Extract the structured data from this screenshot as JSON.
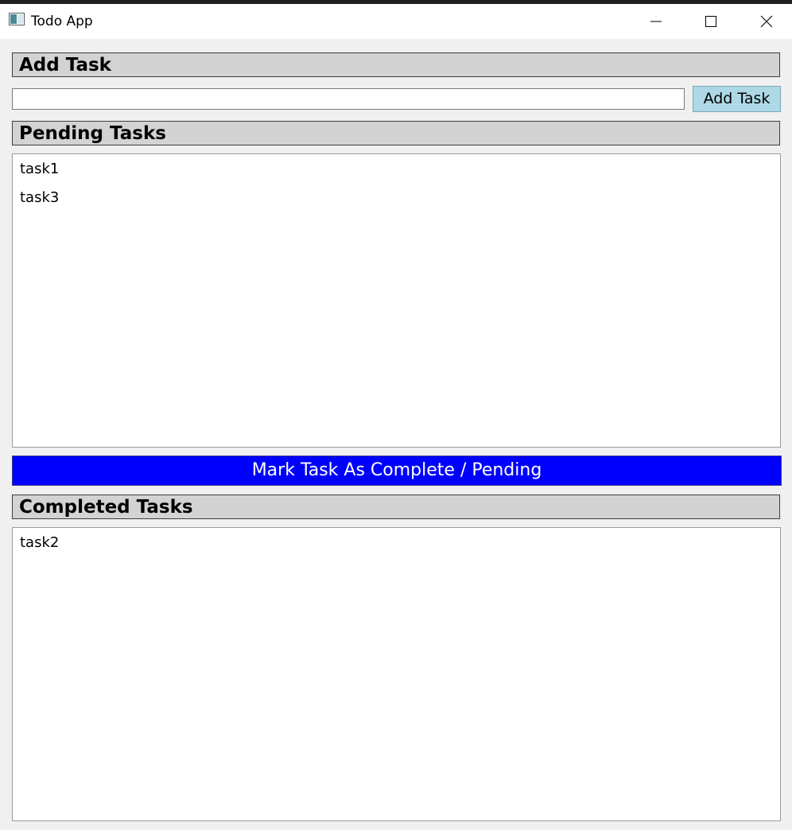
{
  "window": {
    "title": "Todo App"
  },
  "add_section": {
    "header": "Add Task",
    "input_value": "",
    "button_label": "Add Task"
  },
  "pending_section": {
    "header": "Pending Tasks",
    "tasks": [
      "task1",
      "task3"
    ]
  },
  "toggle_button": {
    "label": "Mark Task As Complete / Pending"
  },
  "completed_section": {
    "header": "Completed Tasks",
    "tasks": [
      "task2"
    ]
  },
  "colors": {
    "add_button_bg": "#add8e6",
    "toggle_button_bg": "#0000ff",
    "header_bg": "#d3d3d3"
  },
  "icons": {
    "app": "app-window-icon",
    "minimize": "minimize-icon",
    "maximize": "maximize-icon",
    "close": "close-icon"
  }
}
